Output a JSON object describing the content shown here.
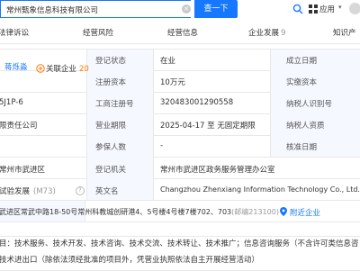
{
  "search": {
    "query": "常州甄象信息科技有限公司",
    "button": "查一下"
  },
  "toolbar": {
    "apps_label": "应用",
    "apps_chevron": "▾"
  },
  "tabs": [
    {
      "label": "法律诉讼",
      "count": ""
    },
    {
      "label": "经营风险",
      "count": ""
    },
    {
      "label": "经营信息",
      "count": ""
    },
    {
      "label": "企业发展",
      "count": "9"
    },
    {
      "label": "知识产",
      "count": ""
    }
  ],
  "profile": {
    "legal_rep": "蒋烁淼",
    "assoc_label": "关联企业",
    "assoc_count": "20"
  },
  "rows": {
    "r1": {
      "left_val": "",
      "label": "登记状态",
      "value": "在业",
      "label2": "成立日期",
      "value2": ""
    },
    "r2": {
      "left_val": "",
      "label": "注册资本",
      "value": "10万元",
      "label2": "实缴资本",
      "value2": ""
    },
    "r3": {
      "left_val": "5J1P-6",
      "label": "工商注册号",
      "value": "320483001290558",
      "label2": "纳税人识别号",
      "value2": ""
    },
    "r4": {
      "left_val": "限责任公司",
      "label": "营业期限",
      "value": "2025-04-17 至 无固定期限",
      "label2": "纳税人资质",
      "value2": ""
    },
    "r5": {
      "left_val": "",
      "label": "参保人数",
      "value": "-",
      "label2": "核准日期",
      "value2": ""
    },
    "r6": {
      "left_val": "常州市武进区",
      "label": "登记机关",
      "value": "常州市武进区政务服务管理办公室"
    },
    "r7": {
      "left_val": "试验发展",
      "left_badge": "(M73)",
      "label": "英文名",
      "value": "Changzhou Zhenxiang Information Technology Co., Ltd."
    }
  },
  "address": {
    "text": "武进区常武中路18-50号常州科教城创研港4、5号楼4号楼7楼702、703",
    "extra": "(邮编213100)",
    "link": "附近企业"
  },
  "scope": {
    "line1": "目：技术服务、技术开发、技术咨询、技术交流、技术转让、技术推广；信息咨询服务（不含许可类信息咨",
    "line2": "技术进出口（除依法须经批准的项目外，凭营业执照依法自主开展经营活动）"
  }
}
